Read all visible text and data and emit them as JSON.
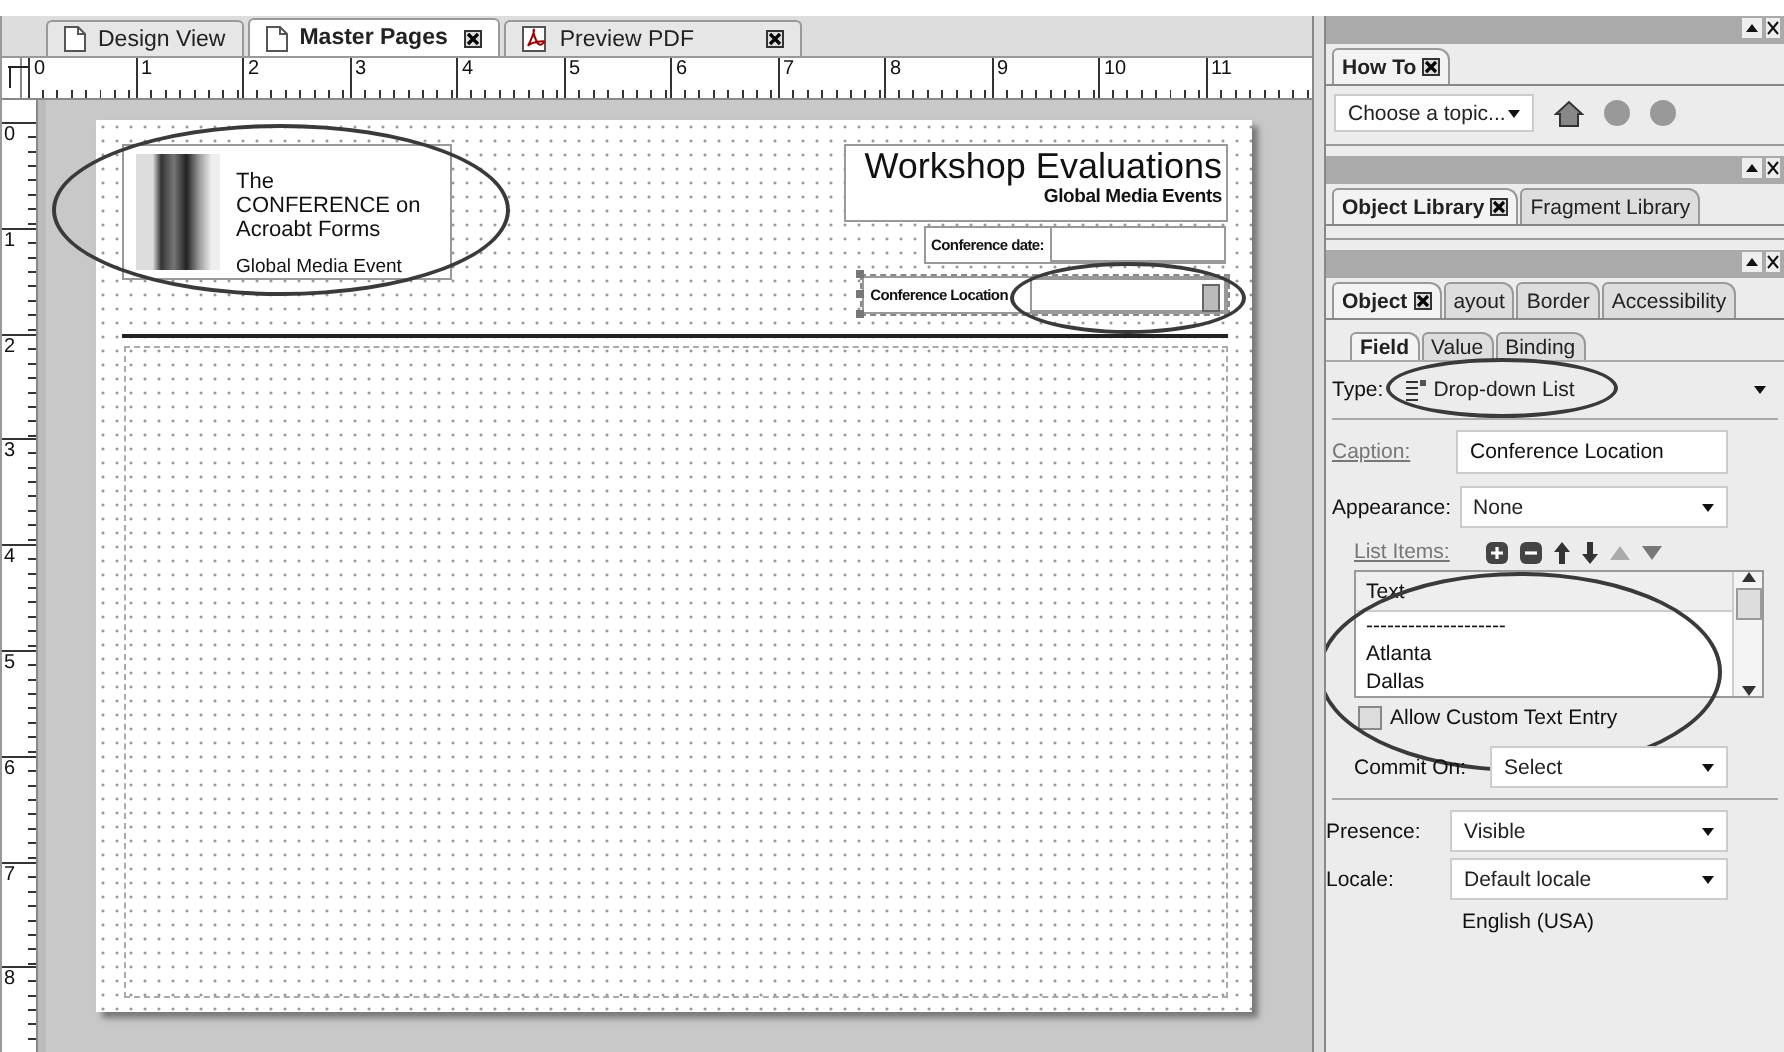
{
  "document_tabs": [
    {
      "label": "Design View",
      "selected": false,
      "closable": false
    },
    {
      "label": "Master Pages",
      "selected": true,
      "closable": true
    },
    {
      "label": "Preview PDF",
      "selected": false,
      "closable": true
    }
  ],
  "ruler": {
    "horizontal": [
      "0",
      "1",
      "2",
      "3",
      "4",
      "5",
      "6",
      "7",
      "8",
      "9",
      "10",
      "11"
    ],
    "vertical": [
      "0",
      "1",
      "2",
      "3",
      "4",
      "5",
      "6",
      "7",
      "8"
    ]
  },
  "page": {
    "logo": {
      "circled": true,
      "title": "The CONFERENCE on Acroabt Forms",
      "subtitle": "Global Media Event"
    },
    "title": "Workshop Evaluations",
    "subtitle": "Global Media Events",
    "fields": [
      {
        "kind": "text",
        "label": "Conference date:",
        "selected": false,
        "circled": false
      },
      {
        "kind": "dropdown",
        "label": "Conference Location",
        "selected": true,
        "circled": true
      }
    ]
  },
  "how_to": {
    "tab": "How To",
    "topic": "Choose a topic..."
  },
  "library_tabs": [
    {
      "label": "Object Library",
      "selected": true
    },
    {
      "label": "Fragment Library",
      "selected": false
    }
  ],
  "object_tabs": [
    {
      "label": "Object",
      "selected": true
    },
    {
      "label": "ayout",
      "selected": false
    },
    {
      "label": "Border",
      "selected": false
    },
    {
      "label": "Accessibility",
      "selected": false
    }
  ],
  "field_tabs": [
    {
      "label": "Field",
      "selected": true
    },
    {
      "label": "Value",
      "selected": false
    },
    {
      "label": "Binding",
      "selected": false
    }
  ],
  "type": {
    "label": "Type:",
    "value": "Drop-down List",
    "circled": true
  },
  "caption": {
    "label": "Caption:",
    "value": "Conference Location"
  },
  "appearance": {
    "label": "Appearance:",
    "value": "None"
  },
  "list_items": {
    "label": "List Items:",
    "column": "Text",
    "items": [
      "--------------------",
      "Atlanta",
      "Dallas"
    ],
    "circled": true
  },
  "allow_custom": {
    "label": "Allow Custom Text Entry",
    "checked": false
  },
  "commit_on": {
    "label": "Commit On:",
    "value": "Select"
  },
  "presence": {
    "label": "Presence:",
    "value": "Visible"
  },
  "locale": {
    "label": "Locale:",
    "value": "Default locale",
    "note": "English (USA)"
  }
}
